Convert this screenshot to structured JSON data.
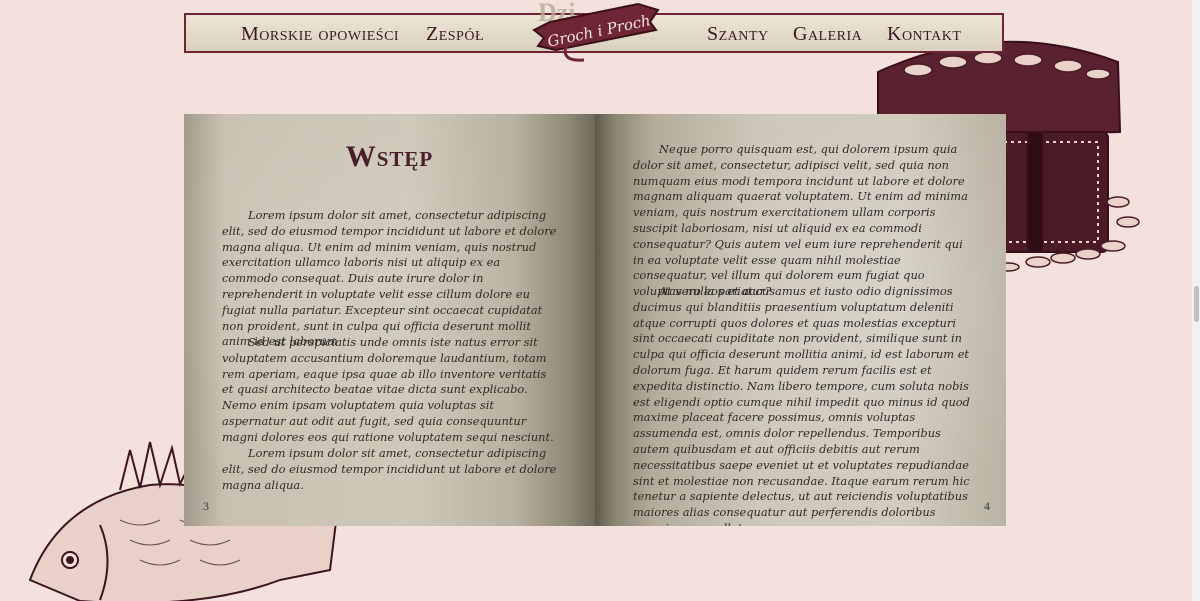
{
  "nav": {
    "left_items": [
      "Morskie opowieści",
      "Zespół"
    ],
    "right_items": [
      "Szanty",
      "Galeria",
      "Kontakt"
    ],
    "logo_text": "Groch i Proch",
    "behind_text": "Dzi"
  },
  "book": {
    "title": "Wstęp",
    "left_paragraphs": [
      "Lorem ipsum dolor sit amet, consectetur adipiscing elit, sed do eiusmod tempor incididunt ut labore et dolore magna aliqua. Ut enim ad minim veniam, quis nostrud exercitation ullamco laboris nisi ut aliquip ex ea commodo consequat. Duis aute irure dolor in reprehenderit in voluptate velit esse cillum dolore eu fugiat nulla pariatur. Excepteur sint occaecat cupidatat non proident, sunt in culpa qui officia deserunt mollit anim id est laborum",
      "Sed ut perspiciatis unde omnis iste natus error sit voluptatem accusantium doloremque laudantium, totam rem aperiam, eaque ipsa quae ab illo inventore veritatis et quasi architecto beatae vitae dicta sunt explicabo. Nemo enim ipsam voluptatem quia voluptas sit aspernatur aut odit aut fugit, sed quia consequuntur magni dolores eos qui ratione voluptatem sequi nesciunt.",
      "Lorem ipsum dolor sit amet, consectetur adipiscing elit, sed do eiusmod tempor incididunt ut labore et dolore magna aliqua."
    ],
    "right_paragraphs": [
      "Neque porro quisquam est, qui dolorem ipsum quia dolor sit amet, consectetur, adipisci velit, sed quia non numquam eius modi tempora incidunt ut labore et dolore magnam aliquam quaerat voluptatem. Ut enim ad minima veniam, quis nostrum exercitationem ullam corporis suscipit laboriosam, nisi ut aliquid ex ea commodi consequatur? Quis autem vel eum iure reprehenderit qui in ea voluptate velit esse quam nihil molestiae consequatur, vel illum qui dolorem eum fugiat quo voluptas nulla pariatur?",
      "At vero eos et accusamus et iusto odio dignissimos ducimus qui blanditiis praesentium voluptatum deleniti atque corrupti quos dolores et quas molestias excepturi sint occaecati cupiditate non provident, similique sunt in culpa qui officia deserunt mollitia animi, id est laborum et dolorum fuga. Et harum quidem rerum facilis est et expedita distinctio. Nam libero tempore, cum soluta nobis est eligendi optio cumque nihil impedit quo minus id quod maxime placeat facere possimus, omnis voluptas assumenda est, omnis dolor repellendus. Temporibus autem quibusdam et aut officiis debitis aut rerum necessitatibus saepe eveniet ut et voluptates repudiandae sint et molestiae non recusandae. Itaque earum rerum hic tenetur a sapiente delectus, ut aut reiciendis voluptatibus maiores alias consequatur aut perferendis doloribus asperiores repellat."
    ],
    "left_page_number": "3",
    "right_page_number": "4"
  },
  "decorations": {
    "chest_icon": "treasure-chest",
    "fish_icon": "fish"
  },
  "colors": {
    "accent": "#6e2535",
    "background": "#f4e1dc",
    "nav_text": "#3c1820",
    "ink": "#2f2a26"
  }
}
